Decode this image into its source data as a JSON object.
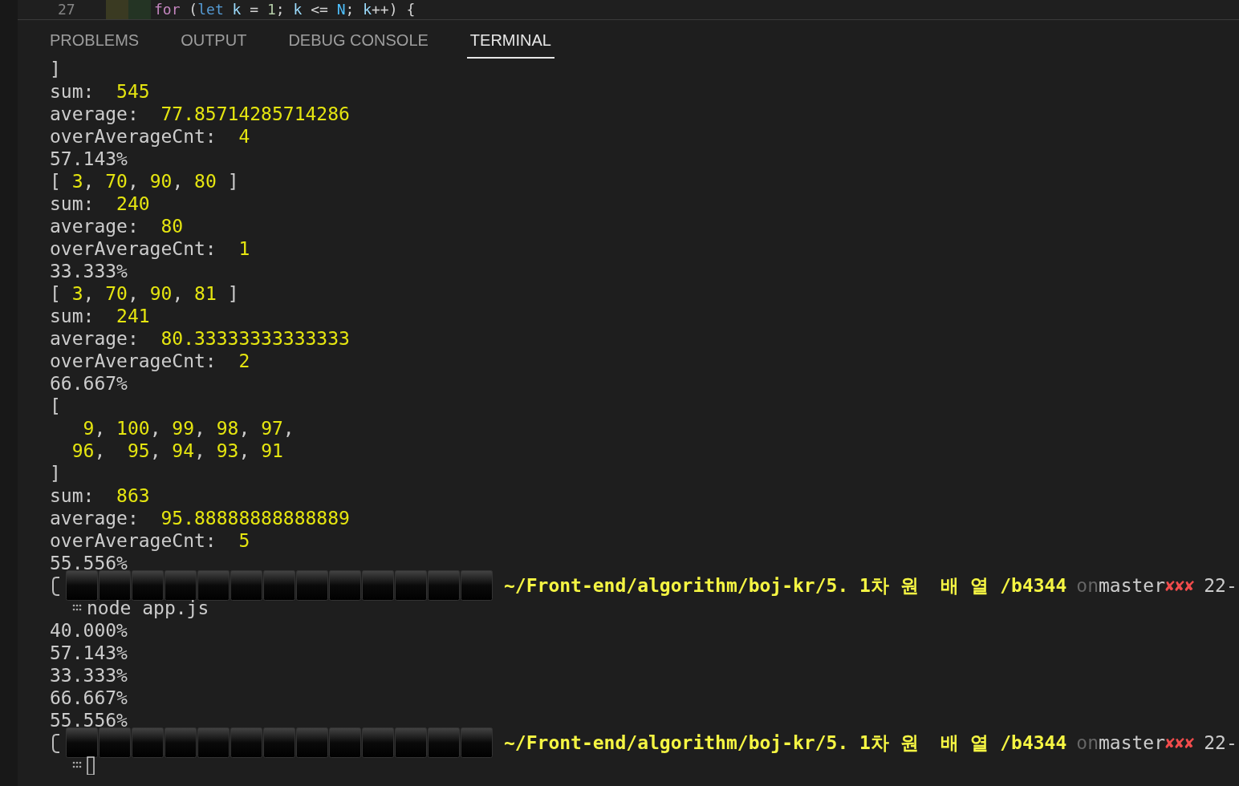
{
  "editor_line": {
    "number": "27",
    "tokens": [
      {
        "text": "for",
        "kind": "keyword"
      },
      {
        "text": " (",
        "kind": "punct"
      },
      {
        "text": "let",
        "kind": "storage"
      },
      {
        "text": " k ",
        "kind": "variable"
      },
      {
        "text": "= ",
        "kind": "punct"
      },
      {
        "text": "1",
        "kind": "number"
      },
      {
        "text": "; ",
        "kind": "punct"
      },
      {
        "text": "k ",
        "kind": "variable"
      },
      {
        "text": "<= ",
        "kind": "punct"
      },
      {
        "text": "N",
        "kind": "constant"
      },
      {
        "text": "; ",
        "kind": "punct"
      },
      {
        "text": "k",
        "kind": "variable"
      },
      {
        "text": "++) {",
        "kind": "punct"
      }
    ]
  },
  "tabs": [
    {
      "label": "PROBLEMS",
      "selected": false
    },
    {
      "label": "OUTPUT",
      "selected": false
    },
    {
      "label": "DEBUG CONSOLE",
      "selected": false
    },
    {
      "label": "TERMINAL",
      "selected": true
    }
  ],
  "terminal": [
    {
      "kind": "output",
      "segments": [
        {
          "text": "]",
          "kind": "plain"
        }
      ]
    },
    {
      "kind": "output",
      "segments": [
        {
          "text": "sum:  ",
          "kind": "plain"
        },
        {
          "text": "545",
          "kind": "value"
        }
      ]
    },
    {
      "kind": "output",
      "segments": [
        {
          "text": "average:  ",
          "kind": "plain"
        },
        {
          "text": "77.85714285714286",
          "kind": "value"
        }
      ]
    },
    {
      "kind": "output",
      "segments": [
        {
          "text": "overAverageCnt:  ",
          "kind": "plain"
        },
        {
          "text": "4",
          "kind": "value"
        }
      ]
    },
    {
      "kind": "output",
      "segments": [
        {
          "text": "57.143%",
          "kind": "plain"
        }
      ]
    },
    {
      "kind": "output",
      "segments": [
        {
          "text": "[ ",
          "kind": "plain"
        },
        {
          "text": "3",
          "kind": "value"
        },
        {
          "text": ", ",
          "kind": "plain"
        },
        {
          "text": "70",
          "kind": "value"
        },
        {
          "text": ", ",
          "kind": "plain"
        },
        {
          "text": "90",
          "kind": "value"
        },
        {
          "text": ", ",
          "kind": "plain"
        },
        {
          "text": "80",
          "kind": "value"
        },
        {
          "text": " ]",
          "kind": "plain"
        }
      ]
    },
    {
      "kind": "output",
      "segments": [
        {
          "text": "sum:  ",
          "kind": "plain"
        },
        {
          "text": "240",
          "kind": "value"
        }
      ]
    },
    {
      "kind": "output",
      "segments": [
        {
          "text": "average:  ",
          "kind": "plain"
        },
        {
          "text": "80",
          "kind": "value"
        }
      ]
    },
    {
      "kind": "output",
      "segments": [
        {
          "text": "overAverageCnt:  ",
          "kind": "plain"
        },
        {
          "text": "1",
          "kind": "value"
        }
      ]
    },
    {
      "kind": "output",
      "segments": [
        {
          "text": "33.333%",
          "kind": "plain"
        }
      ]
    },
    {
      "kind": "output",
      "segments": [
        {
          "text": "[ ",
          "kind": "plain"
        },
        {
          "text": "3",
          "kind": "value"
        },
        {
          "text": ", ",
          "kind": "plain"
        },
        {
          "text": "70",
          "kind": "value"
        },
        {
          "text": ", ",
          "kind": "plain"
        },
        {
          "text": "90",
          "kind": "value"
        },
        {
          "text": ", ",
          "kind": "plain"
        },
        {
          "text": "81",
          "kind": "value"
        },
        {
          "text": " ]",
          "kind": "plain"
        }
      ]
    },
    {
      "kind": "output",
      "segments": [
        {
          "text": "sum:  ",
          "kind": "plain"
        },
        {
          "text": "241",
          "kind": "value"
        }
      ]
    },
    {
      "kind": "output",
      "segments": [
        {
          "text": "average:  ",
          "kind": "plain"
        },
        {
          "text": "80.33333333333333",
          "kind": "value"
        }
      ]
    },
    {
      "kind": "output",
      "segments": [
        {
          "text": "overAverageCnt:  ",
          "kind": "plain"
        },
        {
          "text": "2",
          "kind": "value"
        }
      ]
    },
    {
      "kind": "output",
      "segments": [
        {
          "text": "66.667%",
          "kind": "plain"
        }
      ]
    },
    {
      "kind": "output",
      "segments": [
        {
          "text": "[",
          "kind": "plain"
        }
      ]
    },
    {
      "kind": "output",
      "segments": [
        {
          "text": "   9",
          "kind": "value"
        },
        {
          "text": ", ",
          "kind": "plain"
        },
        {
          "text": "100",
          "kind": "value"
        },
        {
          "text": ", ",
          "kind": "plain"
        },
        {
          "text": "99",
          "kind": "value"
        },
        {
          "text": ", ",
          "kind": "plain"
        },
        {
          "text": "98",
          "kind": "value"
        },
        {
          "text": ", ",
          "kind": "plain"
        },
        {
          "text": "97",
          "kind": "value"
        },
        {
          "text": ",",
          "kind": "plain"
        }
      ]
    },
    {
      "kind": "output",
      "segments": [
        {
          "text": "  96",
          "kind": "value"
        },
        {
          "text": ",  ",
          "kind": "plain"
        },
        {
          "text": "95",
          "kind": "value"
        },
        {
          "text": ", ",
          "kind": "plain"
        },
        {
          "text": "94",
          "kind": "value"
        },
        {
          "text": ", ",
          "kind": "plain"
        },
        {
          "text": "93",
          "kind": "value"
        },
        {
          "text": ", ",
          "kind": "plain"
        },
        {
          "text": "91",
          "kind": "value"
        }
      ]
    },
    {
      "kind": "output",
      "segments": [
        {
          "text": "]",
          "kind": "plain"
        }
      ]
    },
    {
      "kind": "output",
      "segments": [
        {
          "text": "sum:  ",
          "kind": "plain"
        },
        {
          "text": "863",
          "kind": "value"
        }
      ]
    },
    {
      "kind": "output",
      "segments": [
        {
          "text": "average:  ",
          "kind": "plain"
        },
        {
          "text": "95.88888888888889",
          "kind": "value"
        }
      ]
    },
    {
      "kind": "output",
      "segments": [
        {
          "text": "overAverageCnt:  ",
          "kind": "plain"
        },
        {
          "text": "5",
          "kind": "value"
        }
      ]
    },
    {
      "kind": "output",
      "segments": [
        {
          "text": "55.556%",
          "kind": "plain"
        }
      ]
    },
    {
      "kind": "prompt",
      "path": "~/Front-end/algorithm/boj-kr/5. 1차 원  배 열 /b4344",
      "on": "on",
      "branch": "master",
      "status": "✘✘✘",
      "time": "22-",
      "command": "node app.js"
    },
    {
      "kind": "output",
      "segments": [
        {
          "text": "40.000%",
          "kind": "plain"
        }
      ]
    },
    {
      "kind": "output",
      "segments": [
        {
          "text": "57.143%",
          "kind": "plain"
        }
      ]
    },
    {
      "kind": "output",
      "segments": [
        {
          "text": "33.333%",
          "kind": "plain"
        }
      ]
    },
    {
      "kind": "output",
      "segments": [
        {
          "text": "66.667%",
          "kind": "plain"
        }
      ]
    },
    {
      "kind": "output",
      "segments": [
        {
          "text": "55.556%",
          "kind": "plain"
        }
      ]
    },
    {
      "kind": "prompt",
      "path": "~/Front-end/algorithm/boj-kr/5. 1차 원  배 열 /b4344",
      "on": "on",
      "branch": "master",
      "status": "✘✘✘",
      "time": "22-"
    }
  ]
}
